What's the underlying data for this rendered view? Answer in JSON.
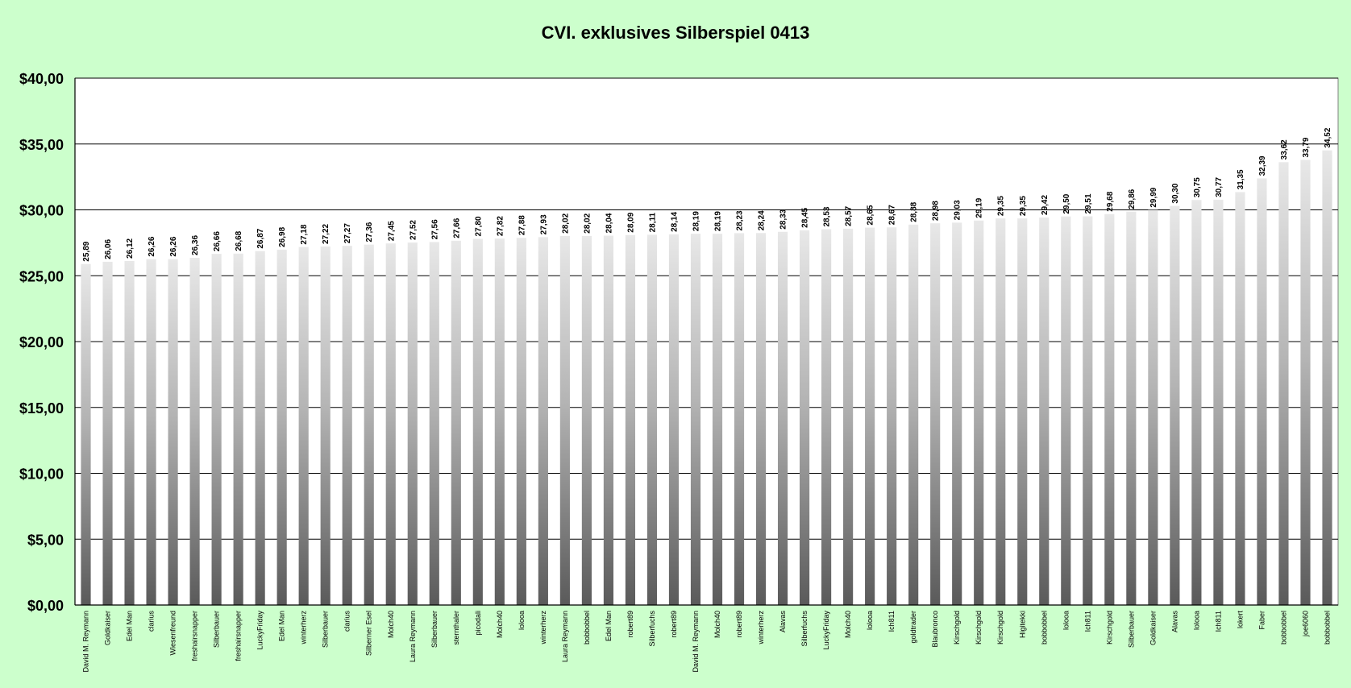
{
  "chart_data": {
    "type": "bar",
    "title": "CVI. exklusives Silberspiel 0413",
    "xlabel": "",
    "ylabel": "",
    "ylim": [
      0,
      40
    ],
    "ytick_values": [
      0,
      5,
      10,
      15,
      20,
      25,
      30,
      35,
      40
    ],
    "ytick_labels": [
      "$0,00",
      "$5,00",
      "$10,00",
      "$15,00",
      "$20,00",
      "$25,00",
      "$30,00",
      "$35,00",
      "$40,00"
    ],
    "grid": true,
    "legend": "none",
    "categories": [
      "David M. Reymann",
      "Goldkaiser",
      "Edel Man",
      "clarius",
      "Wiesenfreund",
      "freshairsnapper",
      "Silberbauer",
      "freshairsnapper",
      "LuckyFriday",
      "Edel Man",
      "winterherz",
      "Silberbauer",
      "clarius",
      "Silberner Esel",
      "Molch40",
      "Laura Reymann",
      "Silberbauer",
      "sternthaler",
      "picodali",
      "Molch40",
      "lolooa",
      "winterherz",
      "Laura Reymann",
      "bobbobbel",
      "Edel Man",
      "robert89",
      "Silberfuchs",
      "robert89",
      "David M. Reymann",
      "Molch40",
      "robert89",
      "winterherz",
      "Alavas",
      "Silberfuchs",
      "LuckyFriday",
      "Molch40",
      "lolooa",
      "Ich811",
      "goldtrader",
      "Blaubronco",
      "Kirschgold",
      "Kirschgold",
      "Kirschgold",
      "Higitekki",
      "bobbobbel",
      "lolooa",
      "Ich811",
      "Kirschgold",
      "Silberbauer",
      "Goldkaiser",
      "Alavas",
      "lolooa",
      "Ich811",
      "lokert",
      "Faber",
      "bobbobbel",
      "joe6060",
      "bobbobbel"
    ],
    "values": [
      25.89,
      26.06,
      26.12,
      26.26,
      26.26,
      26.36,
      26.66,
      26.68,
      26.87,
      26.98,
      27.18,
      27.22,
      27.27,
      27.36,
      27.45,
      27.52,
      27.56,
      27.66,
      27.8,
      27.82,
      27.88,
      27.93,
      28.02,
      28.02,
      28.04,
      28.09,
      28.11,
      28.14,
      28.19,
      28.19,
      28.23,
      28.24,
      28.33,
      28.45,
      28.53,
      28.57,
      28.65,
      28.67,
      28.88,
      28.98,
      29.03,
      29.19,
      29.35,
      29.35,
      29.42,
      29.5,
      29.51,
      29.68,
      29.86,
      29.99,
      30.3,
      30.75,
      30.77,
      31.35,
      32.39,
      33.62,
      33.79,
      34.52
    ],
    "value_labels": [
      "25,89",
      "26,06",
      "26,12",
      "26,26",
      "26,26",
      "26,36",
      "26,66",
      "26,68",
      "26,87",
      "26,98",
      "27,18",
      "27,22",
      "27,27",
      "27,36",
      "27,45",
      "27,52",
      "27,56",
      "27,66",
      "27,80",
      "27,82",
      "27,88",
      "27,93",
      "28,02",
      "28,02",
      "28,04",
      "28,09",
      "28,11",
      "28,14",
      "28,19",
      "28,19",
      "28,23",
      "28,24",
      "28,33",
      "28,45",
      "28,53",
      "28,57",
      "28,65",
      "28,67",
      "28,88",
      "28,98",
      "29,03",
      "29,19",
      "29,35",
      "29,35",
      "29,42",
      "29,50",
      "29,51",
      "29,68",
      "29,86",
      "29,99",
      "30,30",
      "30,75",
      "30,77",
      "31,35",
      "32,39",
      "33,62",
      "33,79",
      "34,52"
    ],
    "colors": {
      "background": "#ccffcc",
      "plot_area": "#ffffff",
      "bar_light": "#e8e8e8",
      "bar_mid": "#b4b4b4",
      "bar_dark": "#5a5a5a",
      "gridline": "#000000"
    }
  }
}
